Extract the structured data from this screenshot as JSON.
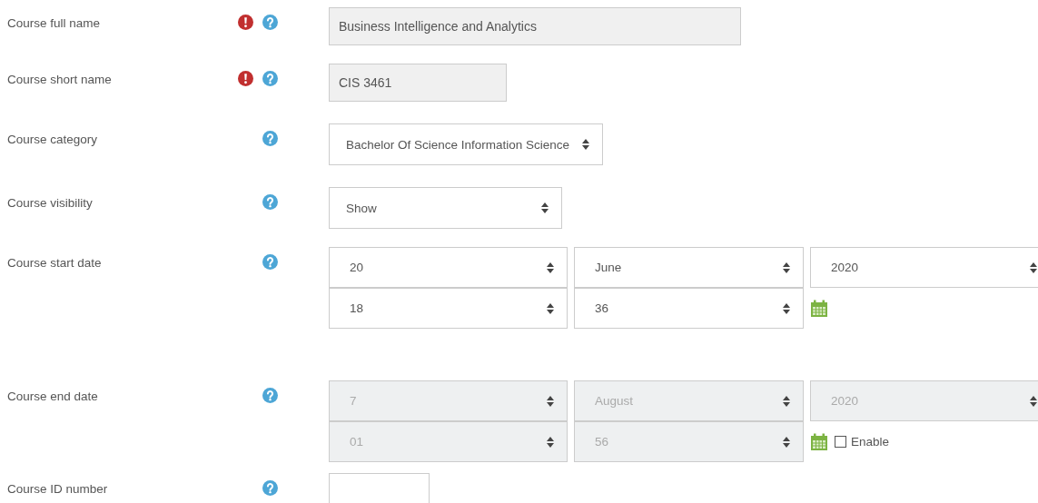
{
  "fields": [
    {
      "kind": "text",
      "label": "Course full name",
      "required": true,
      "value": "Business Intelligence and Analytics",
      "disabled": true
    },
    {
      "kind": "text",
      "label": "Course short name",
      "required": true,
      "value": "CIS 3461",
      "disabled": true
    },
    {
      "kind": "select",
      "label": "Course category",
      "required": false,
      "value": "Bachelor Of Science Information Science"
    },
    {
      "kind": "select",
      "label": "Course visibility",
      "required": false,
      "value": "Show"
    },
    {
      "kind": "date",
      "label": "Course start date",
      "required": false,
      "disabled": false,
      "rows": [
        [
          "20",
          "June",
          "2020"
        ],
        [
          "18",
          "36"
        ]
      ]
    },
    {
      "kind": "date",
      "label": "Course end date",
      "required": false,
      "disabled": true,
      "rows": [
        [
          "7",
          "August",
          "2020"
        ],
        [
          "01",
          "56"
        ]
      ],
      "enable": {
        "label": "Enable",
        "checked": false
      }
    },
    {
      "kind": "text",
      "label": "Course ID number",
      "required": false,
      "disabled": false
    }
  ]
}
